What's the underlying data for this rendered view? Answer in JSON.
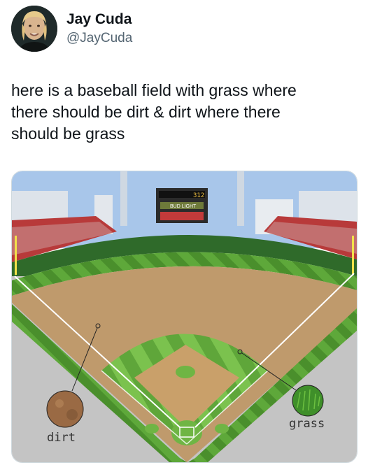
{
  "tweet": {
    "author_name": "Jay Cuda",
    "author_handle": "@JayCuda",
    "text": "here is a baseball field with grass where\nthere should be dirt & dirt where there\nshould be grass"
  },
  "media": {
    "scoreboard_number": "312",
    "scoreboard_sign": "BUD LIGHT",
    "label_dirt": "dirt",
    "label_grass": "grass"
  }
}
